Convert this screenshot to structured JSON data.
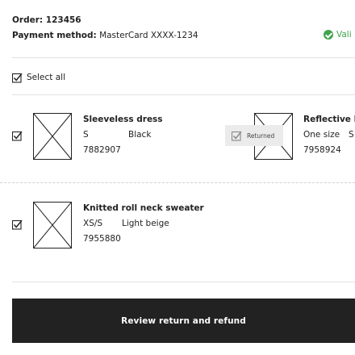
{
  "order": {
    "order_line": "Order: 123456",
    "payment_label": "Payment method:",
    "payment_value": "MasterCard XXXX-1234",
    "validation_text": "Vali",
    "validation_color": "#3fa34d"
  },
  "select_all": {
    "label": "Select all",
    "checked": true
  },
  "items": [
    {
      "name": "Sleeveless dress",
      "size": "S",
      "color": "Black",
      "article": "7882907",
      "checked": true
    },
    {
      "name": "Reflective b",
      "size": "One size",
      "color": "S",
      "article": "7958924",
      "status": "Returned"
    },
    {
      "name": "Knitted roll neck sweater",
      "size": "XS/S",
      "color": "Light beige",
      "article": "7955880",
      "checked": true
    }
  ],
  "cta": {
    "label": "Review return and refund",
    "background": "#222222"
  },
  "icons": [
    "check-circle-icon",
    "checkbox-checked-icon",
    "product-placeholder-icon"
  ]
}
